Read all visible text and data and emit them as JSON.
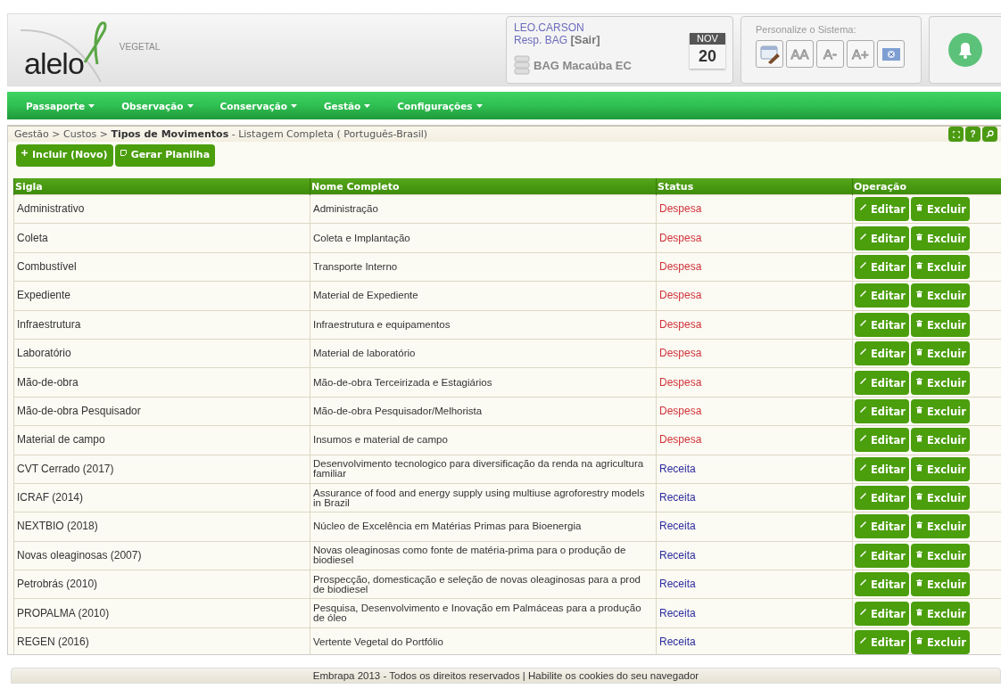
{
  "header": {
    "logo": {
      "name": "alelo",
      "tagline": "VEGETAL"
    },
    "user": {
      "name": "LEO.CARSON",
      "role": "Resp. BAG",
      "logout": "[Sair]",
      "database": "BAG Macaúba EC",
      "date": {
        "month": "NOV",
        "day": "20"
      }
    },
    "personalize": {
      "title": "Personalize o Sistema:",
      "buttons": [
        {
          "kind": "theme"
        },
        {
          "kind": "text",
          "label": "AA"
        },
        {
          "kind": "text",
          "label": "A-"
        },
        {
          "kind": "text",
          "label": "A+"
        },
        {
          "kind": "language"
        }
      ]
    }
  },
  "nav": {
    "items": [
      "Passaporte",
      "Observação",
      "Conservação",
      "Gestão",
      "Configurações"
    ]
  },
  "breadcrumb": {
    "path": "Gestão > Custos > ",
    "current": "Tipos de Movimentos",
    "suffix": " - Listagem Completa ( Português-Brasil)"
  },
  "tools": [
    {
      "kind": "expand"
    },
    {
      "kind": "help",
      "label": "?"
    },
    {
      "kind": "search"
    }
  ],
  "actions": [
    {
      "kind": "add",
      "label": "Incluir (Novo)"
    },
    {
      "kind": "sheet",
      "label": "Gerar Planilha"
    }
  ],
  "table": {
    "columns": [
      "Sigla",
      "Nome Completo",
      "Status",
      "Operação"
    ],
    "rows": [
      {
        "sigla": "Administrativo",
        "nome": "Administração",
        "status": "Despesa",
        "kind": "expense",
        "edit": "Editar",
        "delete": "Excluir"
      },
      {
        "sigla": "Coleta",
        "nome": "Coleta e Implantação",
        "status": "Despesa",
        "kind": "expense",
        "edit": "Editar",
        "delete": "Excluir"
      },
      {
        "sigla": "Combustível",
        "nome": "Transporte Interno",
        "status": "Despesa",
        "kind": "expense",
        "edit": "Editar",
        "delete": "Excluir"
      },
      {
        "sigla": "Expediente",
        "nome": "Material de Expediente",
        "status": "Despesa",
        "kind": "expense",
        "edit": "Editar",
        "delete": "Excluir"
      },
      {
        "sigla": "Infraestrutura",
        "nome": "Infraestrutura e equipamentos",
        "status": "Despesa",
        "kind": "expense",
        "edit": "Editar",
        "delete": "Excluir"
      },
      {
        "sigla": "Laboratório",
        "nome": "Material de laboratório",
        "status": "Despesa",
        "kind": "expense",
        "edit": "Editar",
        "delete": "Excluir"
      },
      {
        "sigla": "Mão-de-obra",
        "nome": "Mão-de-obra Terceirizada e Estagiários",
        "status": "Despesa",
        "kind": "expense",
        "edit": "Editar",
        "delete": "Excluir"
      },
      {
        "sigla": "Mão-de-obra Pesquisador",
        "nome": "Mão-de-obra Pesquisador/Melhorista",
        "status": "Despesa",
        "kind": "expense",
        "edit": "Editar",
        "delete": "Excluir"
      },
      {
        "sigla": "Material de campo",
        "nome": "Insumos e material de campo",
        "status": "Despesa",
        "kind": "expense",
        "edit": "Editar",
        "delete": "Excluir"
      },
      {
        "sigla": "CVT Cerrado (2017)",
        "nome": "Desenvolvimento tecnologico para diversificação da renda na agricultura familiar",
        "status": "Receita",
        "kind": "income",
        "edit": "Editar",
        "delete": "Excluir"
      },
      {
        "sigla": "ICRAF (2014)",
        "nome": "Assurance of food and energy supply using multiuse agroforestry models in Brazil",
        "status": "Receita",
        "kind": "income",
        "edit": "Editar",
        "delete": "Excluir"
      },
      {
        "sigla": "NEXTBIO (2018)",
        "nome": "Núcleo de Excelência em Matérias Primas para Bioenergia",
        "status": "Receita",
        "kind": "income",
        "edit": "Editar",
        "delete": "Excluir"
      },
      {
        "sigla": "Novas oleaginosas (2007)",
        "nome": "Novas oleaginosas como fonte de matéria-prima para o produção de biodiesel",
        "status": "Receita",
        "kind": "income",
        "edit": "Editar",
        "delete": "Excluir"
      },
      {
        "sigla": "Petrobrás (2010)",
        "nome": "Prospecção, domesticação e seleção de novas oleaginosas para a prod de biodiesel",
        "status": "Receita",
        "kind": "income",
        "edit": "Editar",
        "delete": "Excluir"
      },
      {
        "sigla": "PROPALMA (2010)",
        "nome": "Pesquisa, Desenvolvimento e Inovação em Palmáceas para a produção de óleo",
        "status": "Receita",
        "kind": "income",
        "edit": "Editar",
        "delete": "Excluir"
      },
      {
        "sigla": "REGEN (2016)",
        "nome": "Vertente Vegetal do Portfólio",
        "status": "Receita",
        "kind": "income",
        "edit": "Editar",
        "delete": "Excluir"
      }
    ]
  },
  "footer": {
    "text": "Embrapa 2013 - Todos os direitos reservados | Habilite os cookies do seu navegador"
  }
}
